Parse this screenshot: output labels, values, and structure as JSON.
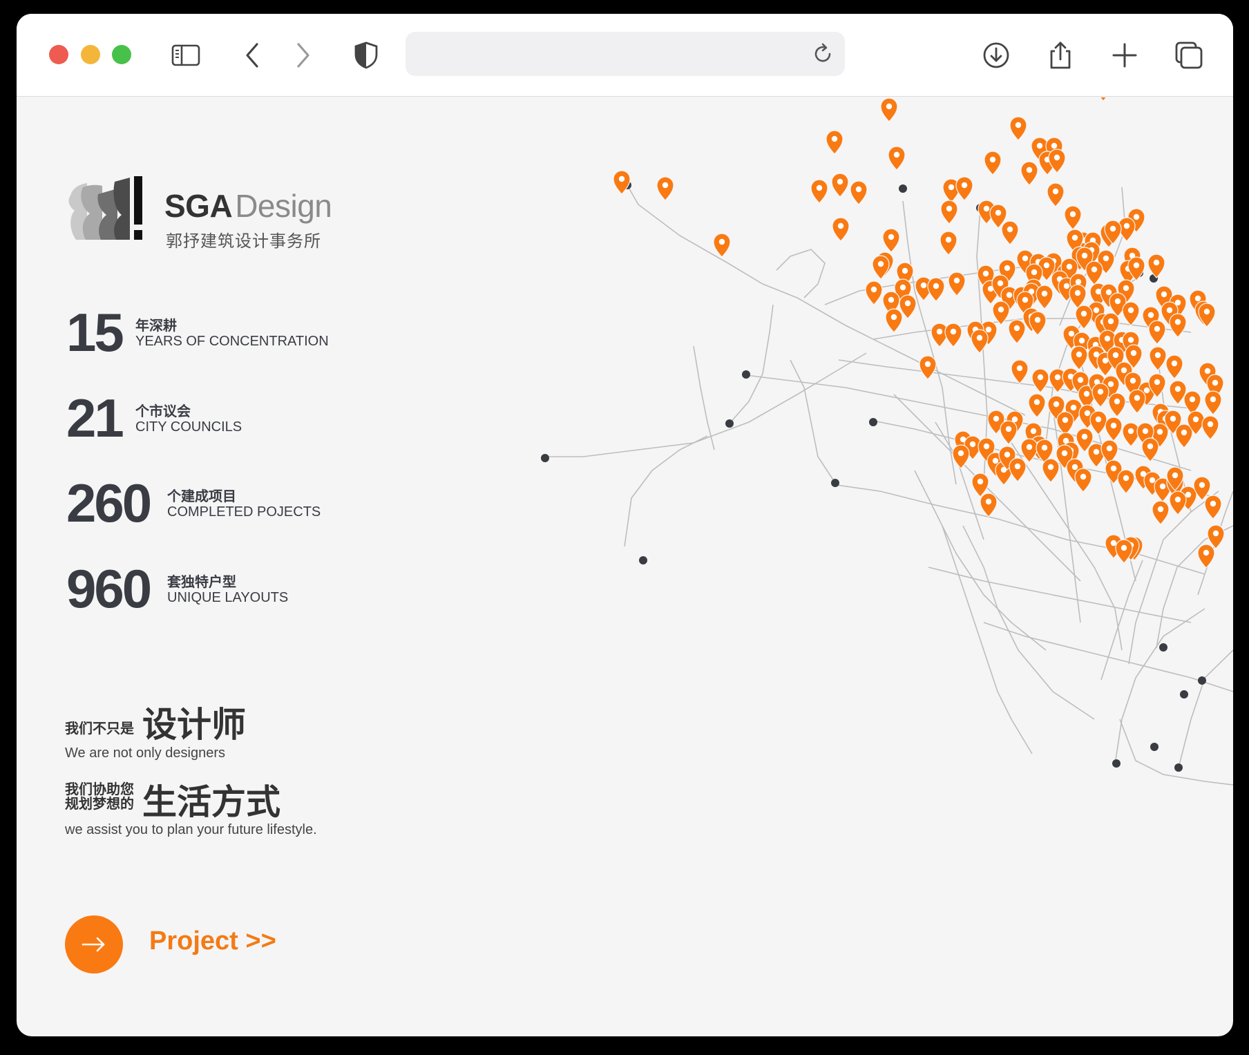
{
  "browser": {
    "address_value": "",
    "address_placeholder": ""
  },
  "brand": {
    "name_bold": "SGA",
    "name_light": "Design",
    "subtitle": "郭抒建筑设计事务所"
  },
  "stats": [
    {
      "number": "15",
      "zh": "年深耕",
      "en": "YEARS OF CONCENTRATION"
    },
    {
      "number": "21",
      "zh": "个市议会",
      "en": "CITY COUNCILS"
    },
    {
      "number": "260",
      "zh": "个建成项目",
      "en": "COMPLETED POJECTS"
    },
    {
      "number": "960",
      "zh": "套独特户型",
      "en": "UNIQUE LAYOUTS"
    }
  ],
  "slogans": [
    {
      "small": "我们不只是",
      "large": "设计师",
      "en": "We are not only designers"
    },
    {
      "small_line1": "我们协助您",
      "small_line2": "规划梦想的",
      "large": "生活方式",
      "en": "we assist you to plan your future lifestyle."
    }
  ],
  "cta": {
    "link_label": "Project >>"
  },
  "colors": {
    "accent": "#f97a12",
    "text": "#3a3c43",
    "map_line": "#bdbdbd",
    "map_node": "#3a3c43"
  }
}
